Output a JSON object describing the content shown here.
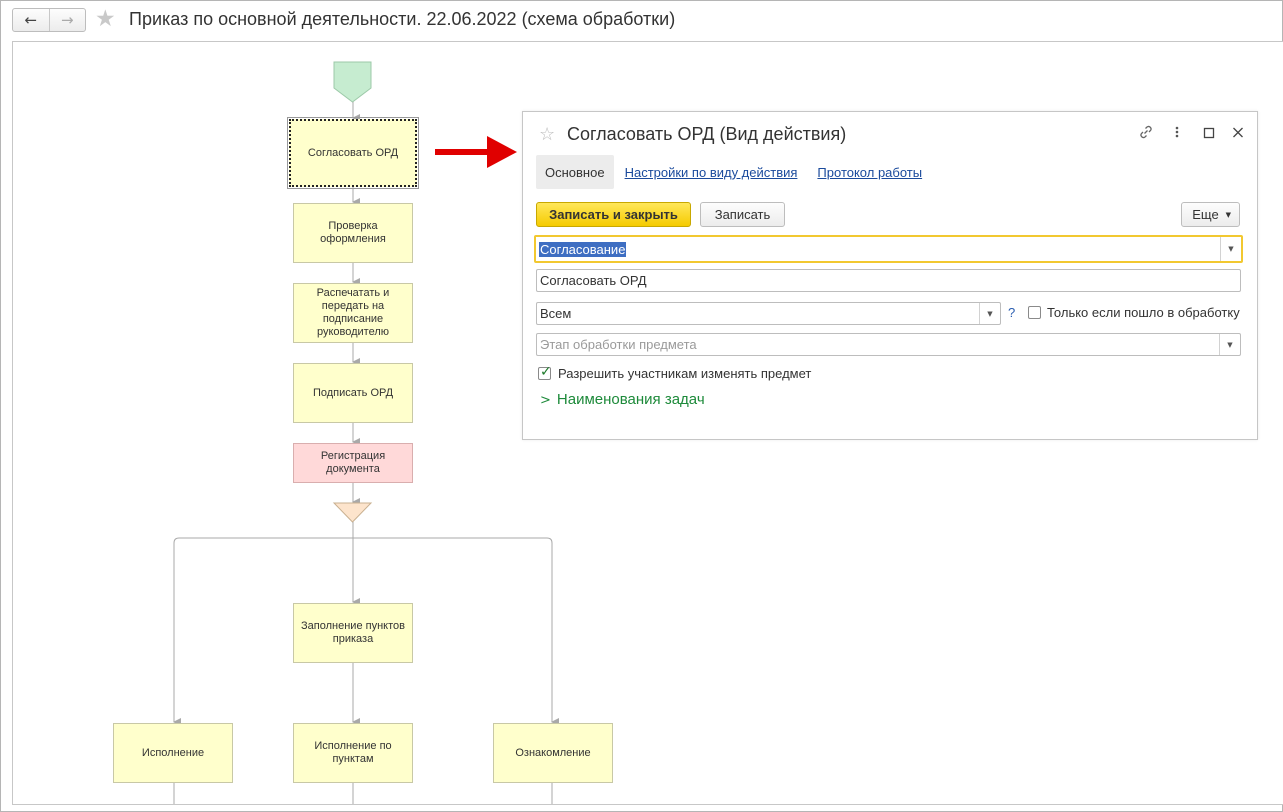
{
  "window": {
    "title": "Приказ по основной деятельности. 22.06.2022 (схема обработки)",
    "nav_back": "←",
    "nav_forward": "→",
    "favorite_icon": "☆"
  },
  "diagram": {
    "nodes": {
      "approve": "Согласовать ОРД",
      "check": "Проверка оформления",
      "print": "Распечатать и передать на подписание руководителю",
      "sign": "Подписать ОРД",
      "register": "Регистрация документа",
      "fill": "Заполнение пунктов приказа",
      "exec": "Исполнение",
      "exec_items": "Исполнение по пунктам",
      "ack": "Ознакомление"
    },
    "colors": {
      "task": "#ffffcc",
      "register": "#ffd9d9",
      "start": "#c6ecd0",
      "fork": "#fde4cc",
      "arrow": "#e00000"
    }
  },
  "dialog": {
    "title": "Согласовать ОРД (Вид действия)",
    "icons": {
      "link": "link-icon",
      "more": "more-icon",
      "maximize": "maximize-icon",
      "close": "close-icon"
    },
    "tabs": {
      "main": "Основное",
      "settings": "Настройки по виду действия",
      "log": "Протокол работы"
    },
    "buttons": {
      "save_close": "Записать и закрыть",
      "save": "Записать",
      "more": "Еще"
    },
    "fields": {
      "type": "Согласование",
      "name": "Согласовать ОРД",
      "performers": "Всем",
      "help": "?",
      "only_if_label": "Только если пошло в обработку",
      "stage_placeholder": "Этап обработки предмета",
      "allow_change_label": "Разрешить участникам изменять предмет",
      "allow_change_checked": true,
      "only_if_checked": false
    },
    "section": "Наименования задач"
  }
}
